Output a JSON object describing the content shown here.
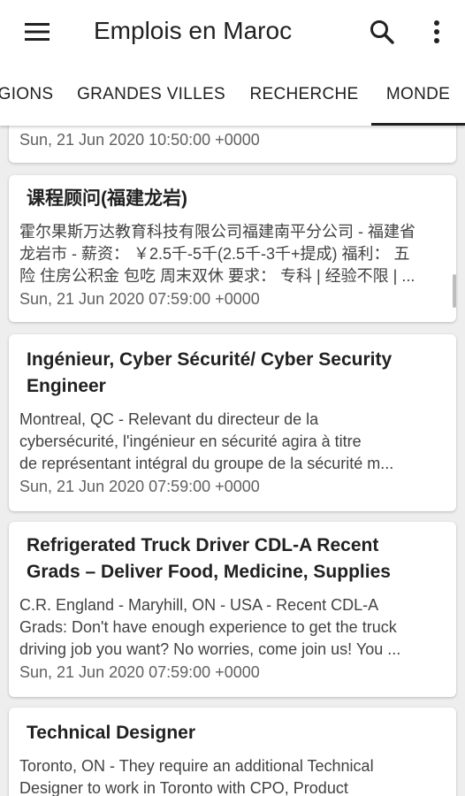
{
  "app": {
    "title": "Emplois en Maroc"
  },
  "toolbar": {
    "menu_icon": "hamburger-menu-icon",
    "search_icon": "search-icon",
    "more_icon": "more-vert-icon"
  },
  "tabs": [
    {
      "label": "GIONS"
    },
    {
      "label": "GRANDES VILLES"
    },
    {
      "label": "RECHERCHE"
    },
    {
      "label": "MONDE",
      "active": true
    }
  ],
  "jobs": [
    {
      "title": "",
      "snippet_lines": [],
      "date": "Sun, 21 Jun 2020 10:50:00 +0000"
    },
    {
      "title": "课程顾问(福建龙岩)",
      "snippet_lines": [
        "霍尔果斯万达教育科技有限公司福建南平分公司 - 福建省",
        "龙岩市 - 薪资： ￥2.5千-5千(2.5千-3千+提成) 福利： 五",
        "险 住房公积金 包吃 周末双休 要求： 专科 | 经验不限 | ..."
      ],
      "date": "Sun, 21 Jun 2020 07:59:00 +0000"
    },
    {
      "title_lines": [
        "Ingénieur, Cyber Sécurité/ Cyber Security",
        "Engineer"
      ],
      "snippet_lines": [
        "Montreal, QC - Relevant du directeur de la",
        "cybersécurité, l'ingénieur en sécurité agira à titre",
        "de représentant intégral du groupe de la sécurité m..."
      ],
      "date": "Sun, 21 Jun 2020 07:59:00 +0000"
    },
    {
      "title_lines": [
        "Refrigerated Truck Driver CDL-A Recent",
        "Grads – Deliver Food, Medicine, Supplies"
      ],
      "snippet_lines": [
        "C.R. England - Maryhill, ON - USA - Recent CDL-A",
        "Grads: Don't have enough experience to get the truck",
        "driving job you want? No worries, come join us! You ..."
      ],
      "date": "Sun, 21 Jun 2020 07:59:00 +0000"
    },
    {
      "title": "Technical Designer",
      "snippet_lines": [
        "Toronto, ON - They require an additional Technical",
        "Designer to work in Toronto with CPO, Product"
      ]
    }
  ]
}
